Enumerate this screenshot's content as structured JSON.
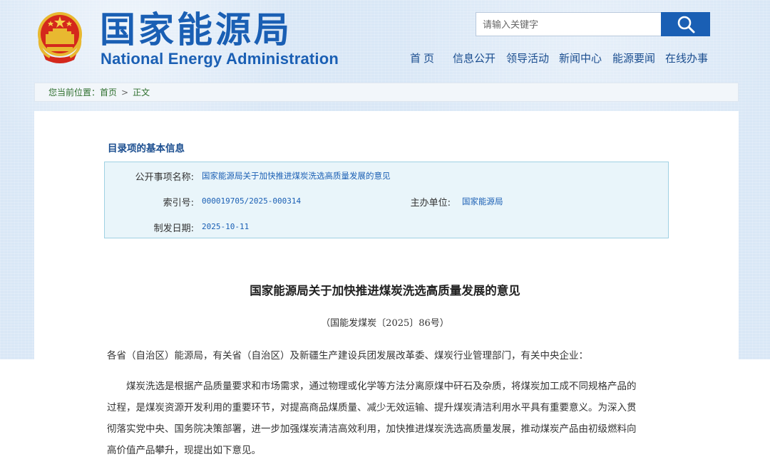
{
  "header": {
    "logo_cn": "国家能源局",
    "logo_en": "National Energy Administration",
    "search_placeholder": "请输入关键字",
    "nav": [
      "首页",
      "信息公开",
      "领导活动",
      "新闻中心",
      "能源要闻",
      "在线办事"
    ]
  },
  "breadcrumb": {
    "prefix": "您当前位置：",
    "home": "首页",
    "current": "正文"
  },
  "info": {
    "section_title": "目录项的基本信息",
    "name_label": "公开事项名称:",
    "name_value": "国家能源局关于加快推进煤炭洗选高质量发展的意见",
    "index_label": "索引号:",
    "index_value": "000019705/2025-000314",
    "org_label": "主办单位:",
    "org_value": "国家能源局",
    "date_label": "制发日期:",
    "date_value": "2025-10-11"
  },
  "document": {
    "title": "国家能源局关于加快推进煤炭洗选高质量发展的意见",
    "number": "（国能发煤炭〔2025〕86号）",
    "salutation": "各省（自治区）能源局，有关省（自治区）及新疆生产建设兵团发展改革委、煤炭行业管理部门，有关中央企业：",
    "paragraph_lines": [
      "　　煤炭洗选是根据产品质量要求和市场需求，通过物理或化学等方法分离原煤中矸石及杂质，将煤炭加工成不同规格产品的",
      "过程，是煤炭资源开发利用的重要环节，对提高商品煤质量、减少无效运输、提升煤炭清洁利用水平具有重要意义。为深入贯",
      "彻落实党中央、国务院决策部署，进一步加强煤炭清洁高效利用，加快推进煤炭洗选高质量发展，推动煤炭产品由初级燃料向",
      "高价值产品攀升，现提出如下意见。"
    ]
  },
  "colors": {
    "brand_blue": "#1a5fb4",
    "header_bg": "#d9e7f6",
    "info_bg": "#e9f5fa",
    "info_border": "#9fd1e3"
  }
}
